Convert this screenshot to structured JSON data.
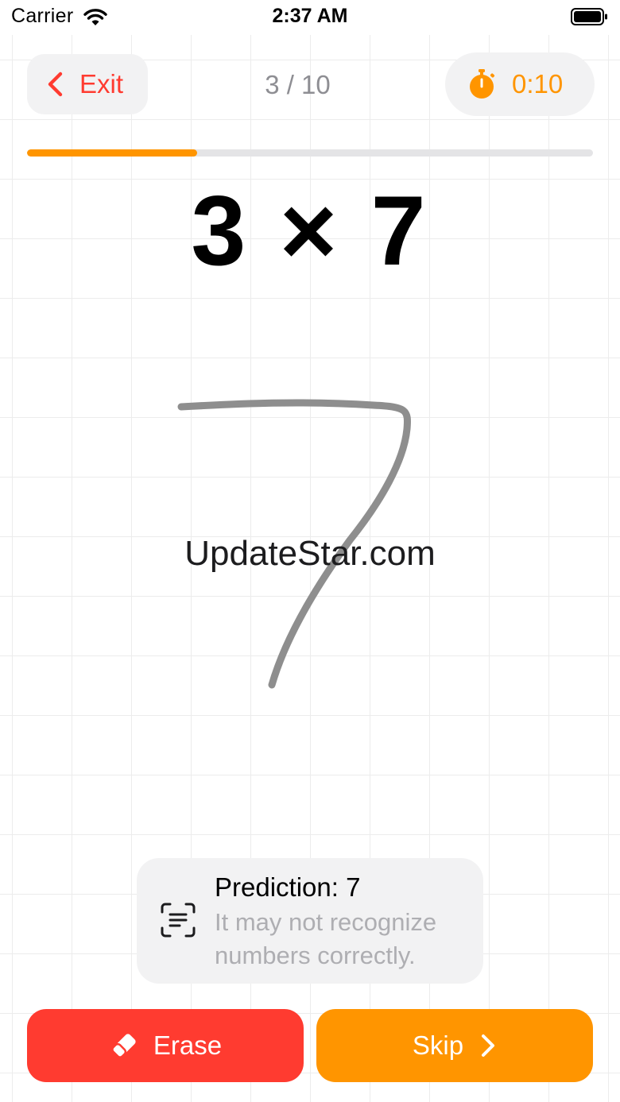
{
  "status_bar": {
    "carrier": "Carrier",
    "time": "2:37 AM",
    "icons": [
      "wifi-icon",
      "battery-icon"
    ]
  },
  "header": {
    "exit_label": "Exit",
    "exit_icon": "chevron-left-icon",
    "progress_text": "3 / 10",
    "timer_icon": "stopwatch-icon",
    "timer_value": "0:10"
  },
  "progress": {
    "current": 3,
    "total": 10,
    "fraction": 0.3
  },
  "question": {
    "text": "3 × 7"
  },
  "canvas": {
    "drawn_answer_glyph": "7",
    "watermark": "UpdateStar.com"
  },
  "prediction": {
    "icon": "text-scan-icon",
    "title": "Prediction: 7",
    "note": "It may not recognize numbers correctly."
  },
  "actions": {
    "erase_label": "Erase",
    "erase_icon": "eraser-icon",
    "skip_label": "Skip",
    "skip_icon": "chevron-right-icon"
  },
  "colors": {
    "accent_orange": "#ff9500",
    "danger_red": "#ff3b30",
    "secondary_gray": "#8e8e93",
    "card_background": "#f2f2f3",
    "stroke_gray": "#8e8e8e"
  }
}
